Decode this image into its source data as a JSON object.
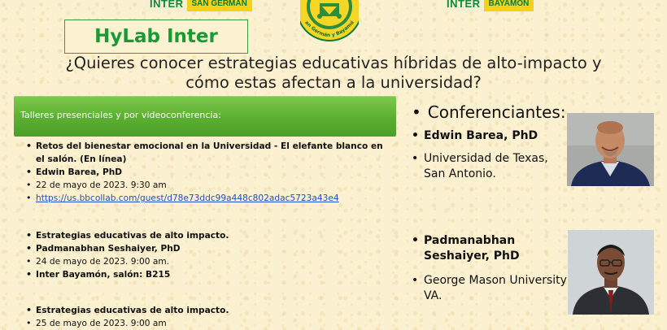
{
  "logos": {
    "san_german": {
      "word": "INTER",
      "campus": "SAN GERMAN"
    },
    "bayamon": {
      "word": "INTER",
      "campus": "BAYAMON"
    },
    "seal_text": "San Germán y Bayamón"
  },
  "title": "HyLab Inter",
  "headline": [
    "¿Quieres conocer estrategias educativas híbridas de alto-impacto y",
    "cómo estas afectan a la universidad?"
  ],
  "banner": "Talleres presenciales y por videoconferencia:",
  "talks": [
    {
      "title": "Retos del bienestar emocional en la Universidad - El elefante blanco en el salón. (En línea)",
      "speaker": "Edwin Barea, PhD",
      "date": "22 de mayo de 2023. 9:30 am",
      "link": "https://us.bbcollab.com/guest/d78e73ddc99a448c802adac5723a43e4"
    },
    {
      "title": "Estrategias educativas de alto impacto.",
      "speaker": "Padmanabhan Seshaiyer, PhD",
      "date": "24 de mayo de 2023. 9:00 am.",
      "location": "Inter Bayamón, salón: B215"
    },
    {
      "title": "Estrategias educativas de alto impacto.",
      "date": "25 de mayo de 2023. 9:00 am"
    }
  ],
  "speakers_header": "Conferenciantes:",
  "speakers": [
    {
      "name": "Edwin Barea, PhD",
      "affiliation": "Universidad de Texas, San Antonio."
    },
    {
      "name": "Padmanabhan Seshaiyer, PhD",
      "affiliation": "George Mason University, VA."
    }
  ],
  "colors": {
    "green": "#1a9a35",
    "banner_green": "#5aae31",
    "background": "#fbf0cf",
    "link": "#1f4fc8"
  }
}
